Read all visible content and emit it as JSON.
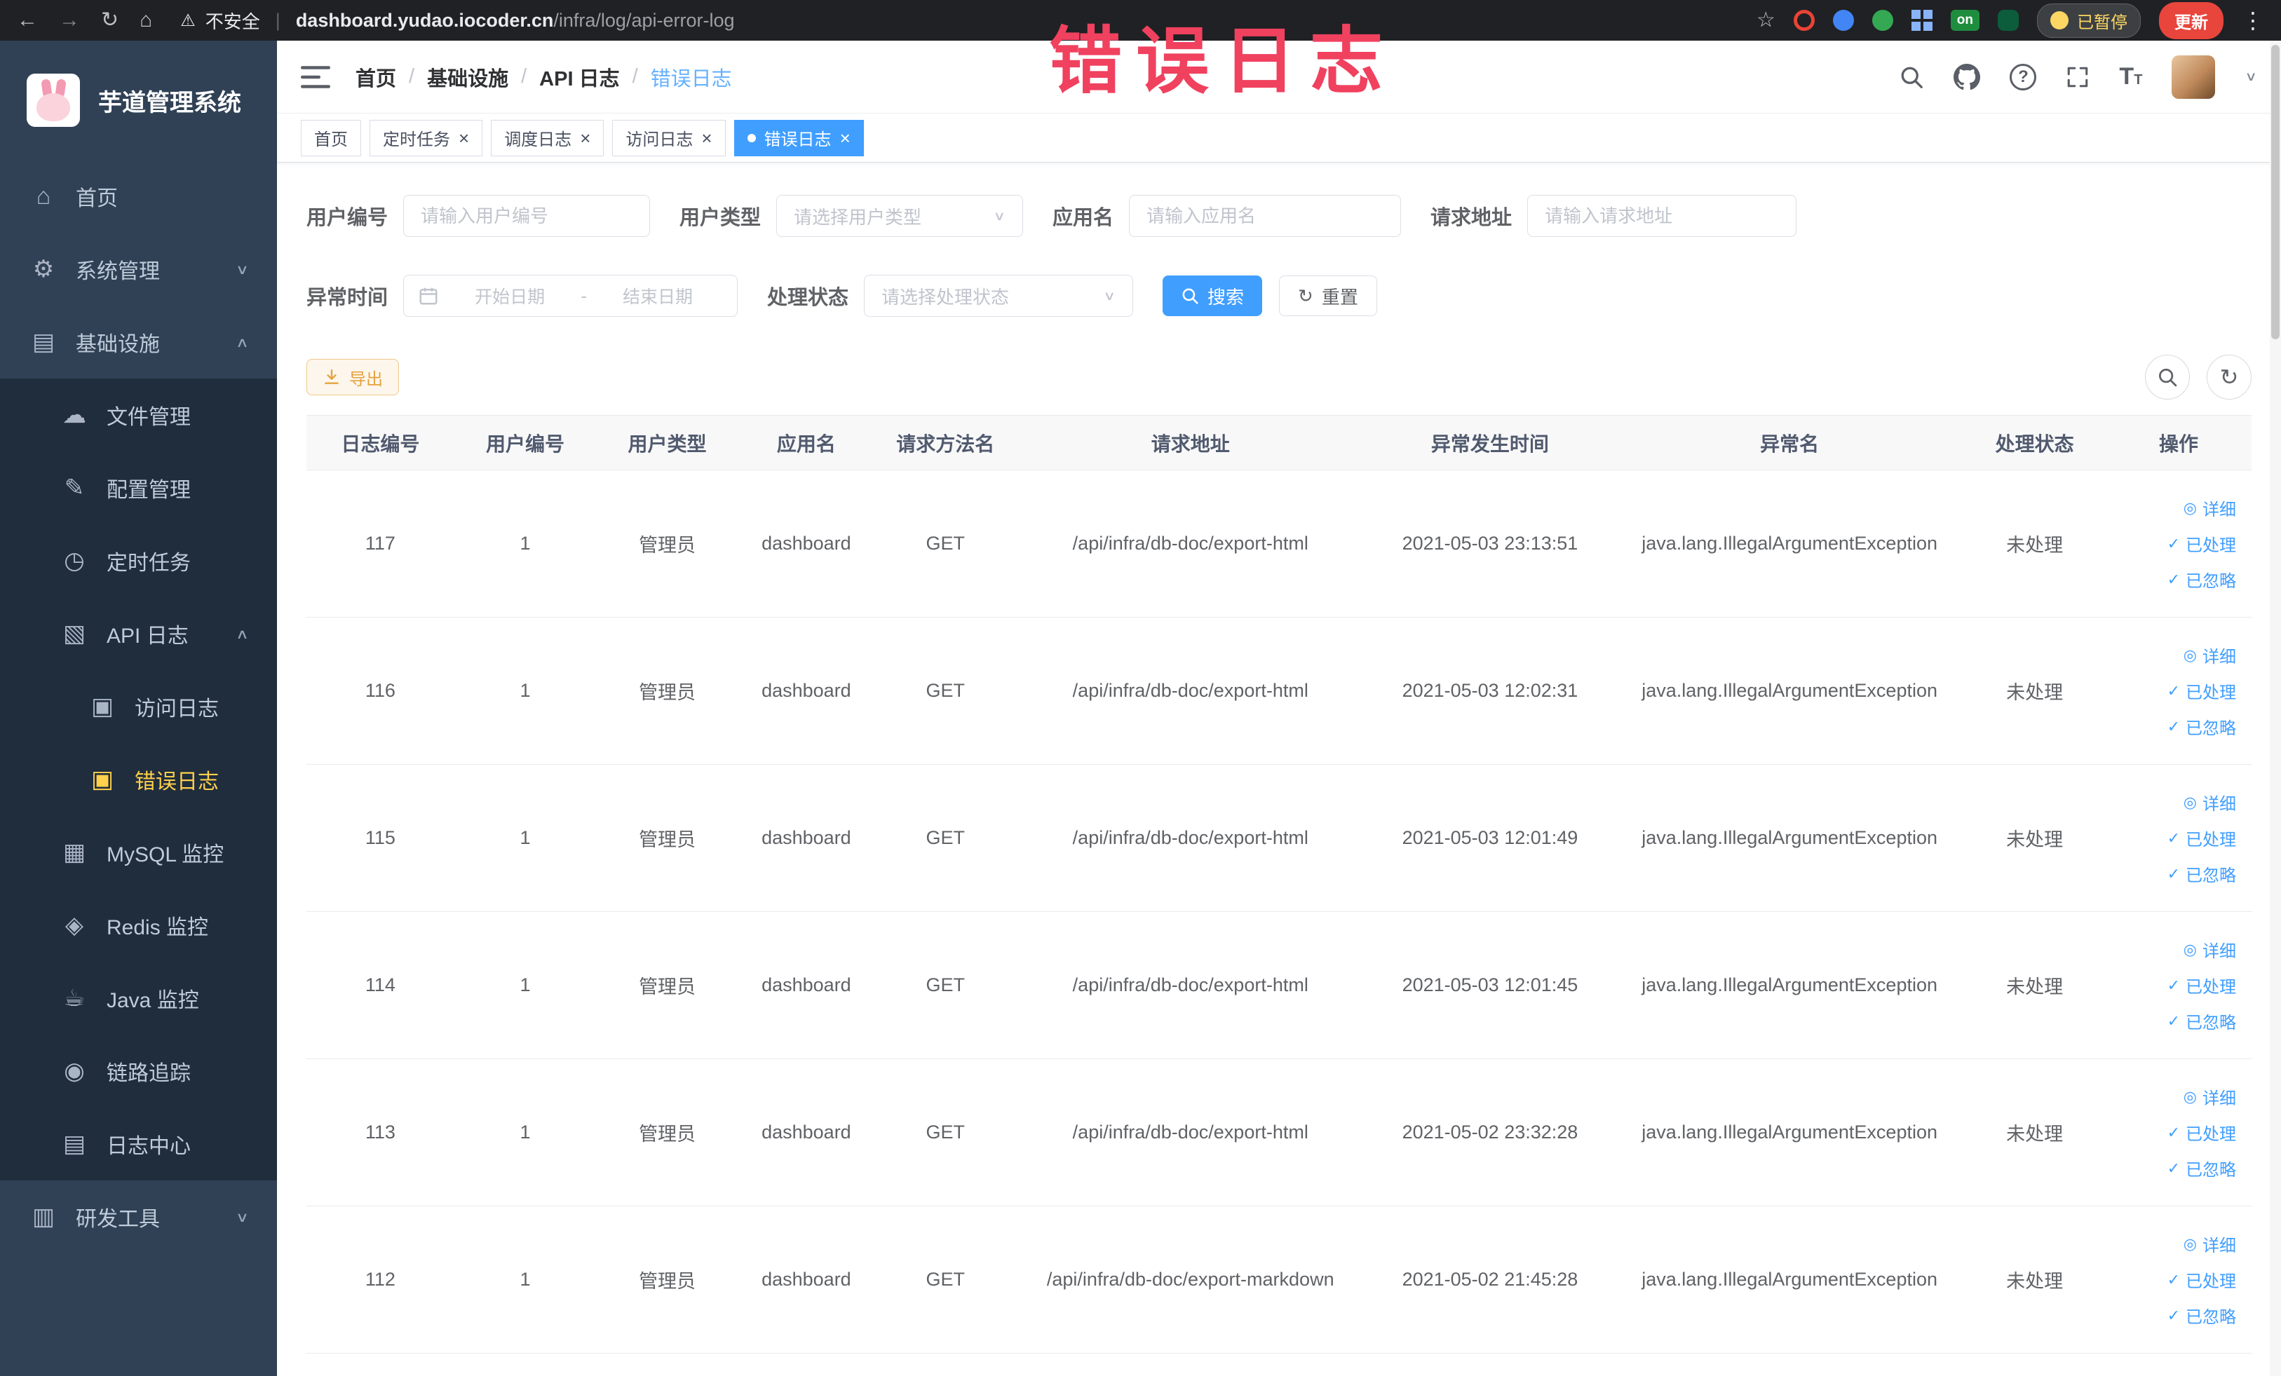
{
  "browser": {
    "security_label": "不安全",
    "url_domain": "dashboard.yudao.iocoder.cn",
    "url_path": "/infra/log/api-error-log",
    "extension_badge_label": "on",
    "paused_badge_label": "已暂停",
    "update_button_label": "更新"
  },
  "annotation": {
    "text": "错误日志"
  },
  "icons": {
    "back": "←",
    "forward": "→",
    "reload": "↻",
    "home-nav": "⌂",
    "warning": "⚠",
    "star": "☆",
    "kebab": "⋮",
    "home": "⌂",
    "gear": "⚙",
    "infra": "▤",
    "cloud": "☁",
    "edit": "✎",
    "clock": "◷",
    "api": "▧",
    "doc": "▣",
    "mysql": "▦",
    "redis": "◈",
    "java": "☕",
    "trace": "◉",
    "log": "▤",
    "tools": "▥",
    "chevron-down": "∨",
    "chevron-up": "∧",
    "check": "✓",
    "eye": "◎",
    "refresh": "↻",
    "close": "×",
    "question": "?"
  },
  "sidebar": {
    "logo_title": "芋道管理系统",
    "items": {
      "home": "首页",
      "system": "系统管理",
      "infra": "基础设施",
      "file": "文件管理",
      "config": "配置管理",
      "job": "定时任务",
      "api_log": "API 日志",
      "access_log": "访问日志",
      "error_log": "错误日志",
      "mysql": "MySQL 监控",
      "redis": "Redis 监控",
      "java": "Java 监控",
      "trace": "链路追踪",
      "log_center": "日志中心",
      "devtools": "研发工具"
    }
  },
  "header": {
    "breadcrumbs": [
      "首页",
      "基础设施",
      "API 日志",
      "错误日志"
    ],
    "separator": "/"
  },
  "tabs": [
    {
      "label": "首页"
    },
    {
      "label": "定时任务"
    },
    {
      "label": "调度日志"
    },
    {
      "label": "访问日志"
    },
    {
      "label": "错误日志"
    }
  ],
  "filters": {
    "user_id": {
      "label": "用户编号",
      "placeholder": "请输入用户编号"
    },
    "user_type": {
      "label": "用户类型",
      "placeholder": "请选择用户类型"
    },
    "app_name": {
      "label": "应用名",
      "placeholder": "请输入应用名"
    },
    "request_url": {
      "label": "请求地址",
      "placeholder": "请输入请求地址"
    },
    "exception_time": {
      "label": "异常时间",
      "start_placeholder": "开始日期",
      "end_placeholder": "结束日期",
      "separator": "-"
    },
    "process_status": {
      "label": "处理状态",
      "placeholder": "请选择处理状态"
    },
    "search_label": "搜索",
    "reset_label": "重置"
  },
  "toolbar": {
    "export_label": "导出"
  },
  "table": {
    "headers": [
      "日志编号",
      "用户编号",
      "用户类型",
      "应用名",
      "请求方法名",
      "请求地址",
      "异常发生时间",
      "异常名",
      "处理状态",
      "操作"
    ],
    "rows": [
      [
        "117",
        "1",
        "管理员",
        "dashboard",
        "GET",
        "/api/infra/db-doc/export-html",
        "2021-05-03 23:13:51",
        "java.lang.IllegalArgumentException",
        "未处理"
      ],
      [
        "116",
        "1",
        "管理员",
        "dashboard",
        "GET",
        "/api/infra/db-doc/export-html",
        "2021-05-03 12:02:31",
        "java.lang.IllegalArgumentException",
        "未处理"
      ],
      [
        "115",
        "1",
        "管理员",
        "dashboard",
        "GET",
        "/api/infra/db-doc/export-html",
        "2021-05-03 12:01:49",
        "java.lang.IllegalArgumentException",
        "未处理"
      ],
      [
        "114",
        "1",
        "管理员",
        "dashboard",
        "GET",
        "/api/infra/db-doc/export-html",
        "2021-05-03 12:01:45",
        "java.lang.IllegalArgumentException",
        "未处理"
      ],
      [
        "113",
        "1",
        "管理员",
        "dashboard",
        "GET",
        "/api/infra/db-doc/export-html",
        "2021-05-02 23:32:28",
        "java.lang.IllegalArgumentException",
        "未处理"
      ],
      [
        "112",
        "1",
        "管理员",
        "dashboard",
        "GET",
        "/api/infra/db-doc/export-markdown",
        "2021-05-02 21:45:28",
        "java.lang.IllegalArgumentException",
        "未处理"
      ]
    ],
    "actions": [
      "详细",
      "已处理",
      "已忽略"
    ]
  }
}
